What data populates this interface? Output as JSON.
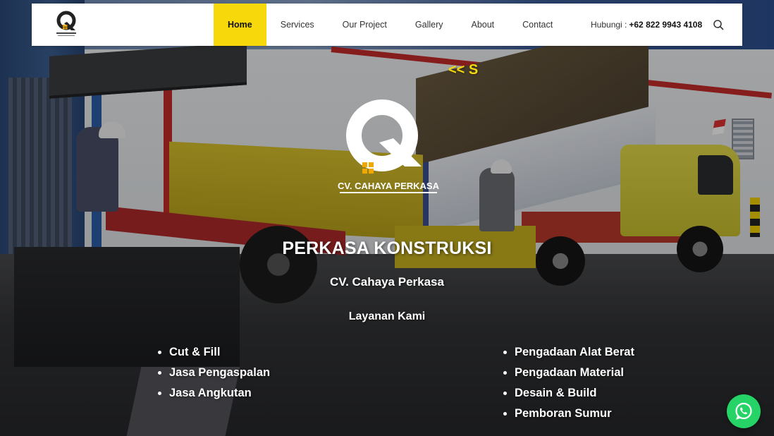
{
  "header": {
    "logo_icon": "cahaya-perkasa-logo",
    "nav": [
      {
        "label": "Home",
        "active": true
      },
      {
        "label": "Services",
        "active": false
      },
      {
        "label": "Our Project",
        "active": false
      },
      {
        "label": "Gallery",
        "active": false
      },
      {
        "label": "About",
        "active": false
      },
      {
        "label": "Contact",
        "active": false
      }
    ],
    "contact_label": "Hubungi :",
    "contact_phone": "+62 822 9943 4108",
    "search_icon": "search-icon"
  },
  "marquee": {
    "text": "<< S"
  },
  "hero": {
    "logo_text": "CV. CAHAYA PERKASA",
    "title": "PERKASA KONSTRUKSI",
    "subtitle": "CV. Cahaya Perkasa",
    "services_heading": "Layanan Kami",
    "services_left": [
      "Cut & Fill",
      "Jasa Pengaspalan",
      "Jasa Angkutan"
    ],
    "services_right": [
      "Pengadaan Alat Berat",
      "Pengadaan Material",
      "Desain & Build",
      "Pemboran Sumur"
    ]
  },
  "floating": {
    "whatsapp_icon": "whatsapp-icon"
  },
  "colors": {
    "accent": "#f6d80b",
    "whatsapp": "#25d366",
    "header_bg": "#ffffff",
    "hero_text": "#ffffff"
  }
}
